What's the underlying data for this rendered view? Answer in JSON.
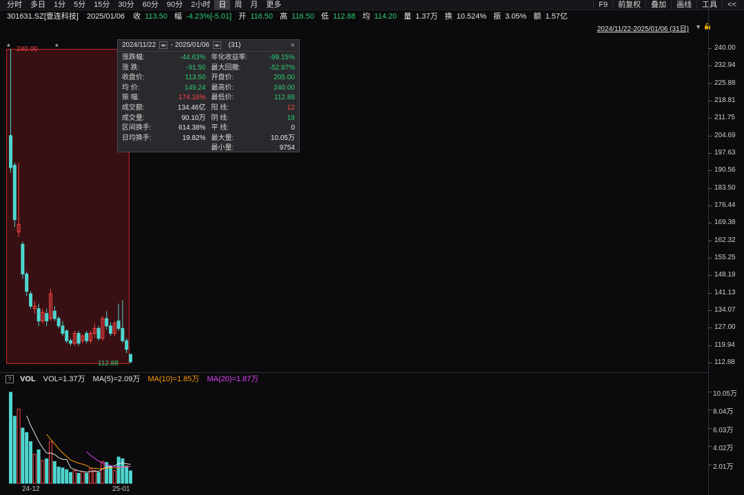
{
  "toolbar": {
    "tabs": [
      "分时",
      "多日",
      "1分",
      "5分",
      "15分",
      "30分",
      "60分",
      "90分",
      "2小时",
      "日",
      "周",
      "月",
      "更多"
    ],
    "active_tab": "日",
    "tools": [
      "F9",
      "前复权",
      "叠加",
      "画线",
      "工具",
      "<<"
    ]
  },
  "quote": {
    "code_name": "301631.SZ[壹连科技]",
    "date": "2025/01/06",
    "close_label": "收",
    "close": "113.50",
    "chg_label": "幅",
    "chg": "-4.23%[-5.01]",
    "open_label": "开",
    "open": "116.50",
    "high_label": "高",
    "high": "116.50",
    "low_label": "低",
    "low": "112.88",
    "avg_label": "均",
    "avg": "114.20",
    "vol_label": "量",
    "vol": "1.37万",
    "turnover_label": "换",
    "turnover": "10.524%",
    "amp_label": "振",
    "amp": "3.05%",
    "amount_label": "额",
    "amount": "1.57亿"
  },
  "range_link": "2024/11/22-2025/01/06 (31日)",
  "price_axis": [
    "240.00",
    "232.94",
    "225.88",
    "218.81",
    "211.75",
    "204.69",
    "197.63",
    "190.56",
    "183.50",
    "176.44",
    "169.38",
    "162.32",
    "155.25",
    "148.19",
    "141.13",
    "134.07",
    "127.00",
    "119.94",
    "112.88"
  ],
  "vol_axis": [
    "10.05万",
    "8.04万",
    "6.03万",
    "4.02万",
    "2.01万"
  ],
  "selection": {
    "high_label": "240.00",
    "low_label": "112.88"
  },
  "popup": {
    "start": "2024/11/22",
    "end": "2025/01/06",
    "count": "(31)",
    "close": "×",
    "left": [
      {
        "label": "涨跌幅:",
        "value": "-44.63%",
        "color": "green"
      },
      {
        "label": "涨  跌:",
        "value": "-91.50",
        "color": "green"
      },
      {
        "label": "收盘价:",
        "value": "113.50",
        "color": "green"
      },
      {
        "label": "均  价:",
        "value": "149.24",
        "color": "green"
      },
      {
        "label": "振  幅:",
        "value": "174.16%",
        "color": "red"
      },
      {
        "label": "成交额:",
        "value": "134.46亿",
        "color": "white"
      },
      {
        "label": "成交量:",
        "value": "90.10万",
        "color": "white"
      },
      {
        "label": "区间换手:",
        "value": "614.38%",
        "color": "white"
      },
      {
        "label": "日均换手:",
        "value": "19.82%",
        "color": "white"
      }
    ],
    "right": [
      {
        "label": "年化收益率:",
        "value": "-99.15%",
        "color": "green"
      },
      {
        "label": "最大回撤:",
        "value": "-52.97%",
        "color": "green"
      },
      {
        "label": "开盘价:",
        "value": "205.00",
        "color": "green"
      },
      {
        "label": "最高价:",
        "value": "240.00",
        "color": "green"
      },
      {
        "label": "最低价:",
        "value": "112.88",
        "color": "green"
      },
      {
        "label": "阳  线:",
        "value": "12",
        "color": "red"
      },
      {
        "label": "阴  线:",
        "value": "19",
        "color": "green"
      },
      {
        "label": "平  线:",
        "value": "0",
        "color": "white"
      },
      {
        "label": "最大量:",
        "value": "10.05万",
        "color": "white"
      },
      {
        "label": "最小量:",
        "value": "9754",
        "color": "white"
      }
    ]
  },
  "vol_legend": {
    "title": "VOL",
    "vol": "VOL=1.37万",
    "ma5": "MA(5)=2.09万",
    "ma10": "MA(10)=1.85万",
    "ma20": "MA(20)=1.87万"
  },
  "date_labels": [
    "24-12",
    "25-01"
  ],
  "colors": {
    "up": "#ff4444",
    "down": "#2ecc71",
    "candle_down": "#4fd6d0",
    "ma5": "#e8e8e8",
    "ma10": "#ff9900",
    "ma20": "#e040fb"
  },
  "chart_data": {
    "type": "candlestick",
    "ylim": [
      112.88,
      240.0
    ],
    "vol_ylim": [
      0,
      10.05
    ],
    "candles": [
      {
        "o": 205.0,
        "h": 240.0,
        "l": 190.0,
        "c": 192.0,
        "v": 10.05
      },
      {
        "o": 193.0,
        "h": 194.0,
        "l": 168.0,
        "c": 171.0,
        "v": 7.4
      },
      {
        "o": 166.0,
        "h": 194.0,
        "l": 164.0,
        "c": 169.0,
        "v": 8.2
      },
      {
        "o": 161.0,
        "h": 162.0,
        "l": 147.0,
        "c": 149.0,
        "v": 6.1
      },
      {
        "o": 149.0,
        "h": 150.0,
        "l": 140.0,
        "c": 142.0,
        "v": 5.6
      },
      {
        "o": 141.0,
        "h": 142.0,
        "l": 135.0,
        "c": 136.0,
        "v": 4.6
      },
      {
        "o": 135.0,
        "h": 138.0,
        "l": 133.0,
        "c": 136.0,
        "v": 3.2
      },
      {
        "o": 135.0,
        "h": 137.0,
        "l": 128.0,
        "c": 130.0,
        "v": 3.7
      },
      {
        "o": 130.0,
        "h": 135.0,
        "l": 129.0,
        "c": 133.5,
        "v": 2.5
      },
      {
        "o": 133.0,
        "h": 135.0,
        "l": 128.0,
        "c": 130.0,
        "v": 2.7
      },
      {
        "o": 131.0,
        "h": 143.0,
        "l": 130.0,
        "c": 141.0,
        "v": 4.6
      },
      {
        "o": 134.0,
        "h": 136.0,
        "l": 130.0,
        "c": 131.0,
        "v": 2.4
      },
      {
        "o": 131.0,
        "h": 132.0,
        "l": 127.0,
        "c": 128.0,
        "v": 1.8
      },
      {
        "o": 128.0,
        "h": 130.0,
        "l": 124.0,
        "c": 125.0,
        "v": 1.7
      },
      {
        "o": 126.0,
        "h": 126.5,
        "l": 121.0,
        "c": 122.0,
        "v": 1.5
      },
      {
        "o": 122.0,
        "h": 123.0,
        "l": 120.0,
        "c": 121.0,
        "v": 1.2
      },
      {
        "o": 121.0,
        "h": 126.0,
        "l": 120.0,
        "c": 125.0,
        "v": 1.4
      },
      {
        "o": 125.0,
        "h": 126.0,
        "l": 120.0,
        "c": 121.0,
        "v": 1.1
      },
      {
        "o": 122.0,
        "h": 124.5,
        "l": 121.0,
        "c": 124.0,
        "v": 1.3
      },
      {
        "o": 125.0,
        "h": 126.0,
        "l": 121.0,
        "c": 122.0,
        "v": 1.1
      },
      {
        "o": 122.0,
        "h": 126.0,
        "l": 121.0,
        "c": 125.0,
        "v": 1.6
      },
      {
        "o": 125.0,
        "h": 129.0,
        "l": 123.0,
        "c": 127.0,
        "v": 1.4
      },
      {
        "o": 127.0,
        "h": 128.0,
        "l": 122.0,
        "c": 123.0,
        "v": 1.2
      },
      {
        "o": 123.0,
        "h": 132.0,
        "l": 122.0,
        "c": 131.0,
        "v": 2.4
      },
      {
        "o": 131.0,
        "h": 134.0,
        "l": 126.5,
        "c": 128.0,
        "v": 2.3
      },
      {
        "o": 128.0,
        "h": 129.5,
        "l": 124.0,
        "c": 125.0,
        "v": 1.9
      },
      {
        "o": 125.0,
        "h": 130.0,
        "l": 124.0,
        "c": 129.0,
        "v": 1.4
      },
      {
        "o": 130.0,
        "h": 137.0,
        "l": 126.0,
        "c": 127.0,
        "v": 2.9
      },
      {
        "o": 127.0,
        "h": 138.5,
        "l": 121.0,
        "c": 122.0,
        "v": 2.7
      },
      {
        "o": 122.0,
        "h": 123.0,
        "l": 117.0,
        "c": 118.5,
        "v": 1.9
      },
      {
        "o": 116.5,
        "h": 116.5,
        "l": 112.88,
        "c": 113.5,
        "v": 1.37
      }
    ],
    "ma5": [
      null,
      null,
      null,
      null,
      7.47,
      6.38,
      5.54,
      4.64,
      3.92,
      3.34,
      3.34,
      3.18,
      2.84,
      2.64,
      2.64,
      1.72,
      1.52,
      1.38,
      1.3,
      1.22,
      1.3,
      1.32,
      1.32,
      1.58,
      1.78,
      1.84,
      1.94,
      2.18,
      2.24,
      2.16,
      2.09
    ],
    "ma10": [
      null,
      null,
      null,
      null,
      null,
      null,
      null,
      null,
      null,
      5.41,
      4.86,
      4.36,
      3.81,
      3.36,
      2.97,
      2.56,
      2.4,
      2.22,
      2.11,
      1.96,
      1.69,
      1.66,
      1.6,
      1.63,
      1.68,
      1.71,
      1.68,
      1.7,
      1.84,
      1.88,
      1.85
    ],
    "ma20": [
      null,
      null,
      null,
      null,
      null,
      null,
      null,
      null,
      null,
      null,
      null,
      null,
      null,
      null,
      null,
      null,
      null,
      null,
      null,
      3.49,
      3.07,
      2.76,
      2.45,
      2.23,
      2.07,
      1.95,
      1.86,
      1.79,
      1.81,
      1.82,
      1.87
    ]
  }
}
